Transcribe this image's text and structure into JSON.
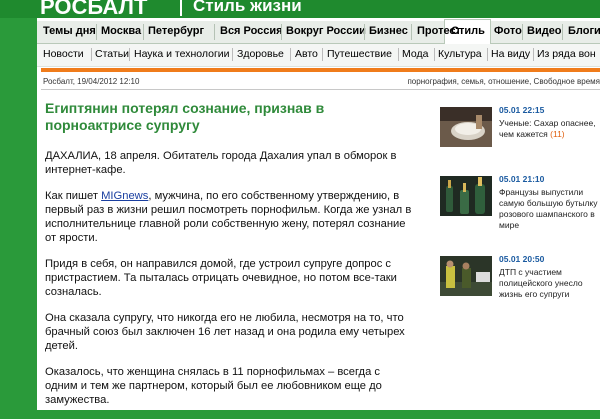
{
  "header": {
    "logo": "РОСБАЛТ",
    "slogan": "Стиль жизни"
  },
  "nav_main": {
    "items": [
      "Темы дня",
      "Москва",
      "Петербург",
      "Вся Россия",
      "Вокруг России",
      "Бизнес",
      "Протест",
      "Стиль",
      "Фото",
      "Видео",
      "Блоги"
    ],
    "active": "Стиль"
  },
  "nav_sub": [
    "Новости",
    "Статьи",
    "Наука и технологии",
    "Здоровье",
    "Авто",
    "Путешествие",
    "Мода",
    "Культура",
    "На виду",
    "Из ряда вон"
  ],
  "meta": {
    "source_date": "Росбалт, 19/04/2012 12:10",
    "tags": "порнография, семья, отношение, Свободное время"
  },
  "article": {
    "title": "Египтянин потерял сознание, признав в порноактрисе супругу",
    "p1": "ДАХАЛИА, 18 апреля. Обитатель города Дахалия упал в обморок в интернет-кафе.",
    "p2_before": "Как пишет ",
    "p2_link": "MIGnews",
    "p2_after": ", мужчина, по его собственному утверждению, в первый раз в жизни решил посмотреть порнофильм. Когда же узнал в исполнительнице главной роли собственную жену, потерял сознание от ярости.",
    "p3": "Придя в себя, он направился домой, где устроил супруге допрос с пристрастием. Та пыталась отрицать очевидное, но потом все-таки созналась.",
    "p4": "Она сказала супругу, что никогда его не любила, несмотря на то, что брачный союз был заключен 16 лет назад и она родила ему четырех детей.",
    "p5": "Оказалось, что женщина снялась в 11 порнофильмах – всегда с одним и тем же партнером, который был ее любовником еще до замужества."
  },
  "sidebar_news": [
    {
      "time": "05.01 22:15",
      "text": "Ученые: Сахар опаснее, чем кажется",
      "count": "(11)",
      "icon": "sugar-photo"
    },
    {
      "time": "05.01 21:10",
      "text": "Французы выпустили самую большую бутылку розового шампанского в мире",
      "count": "",
      "icon": "champagne-photo"
    },
    {
      "time": "05.01 20:50",
      "text": "ДТП с участием полицейского унесло жизнь его супруги",
      "count": "",
      "icon": "police-photo"
    }
  ]
}
